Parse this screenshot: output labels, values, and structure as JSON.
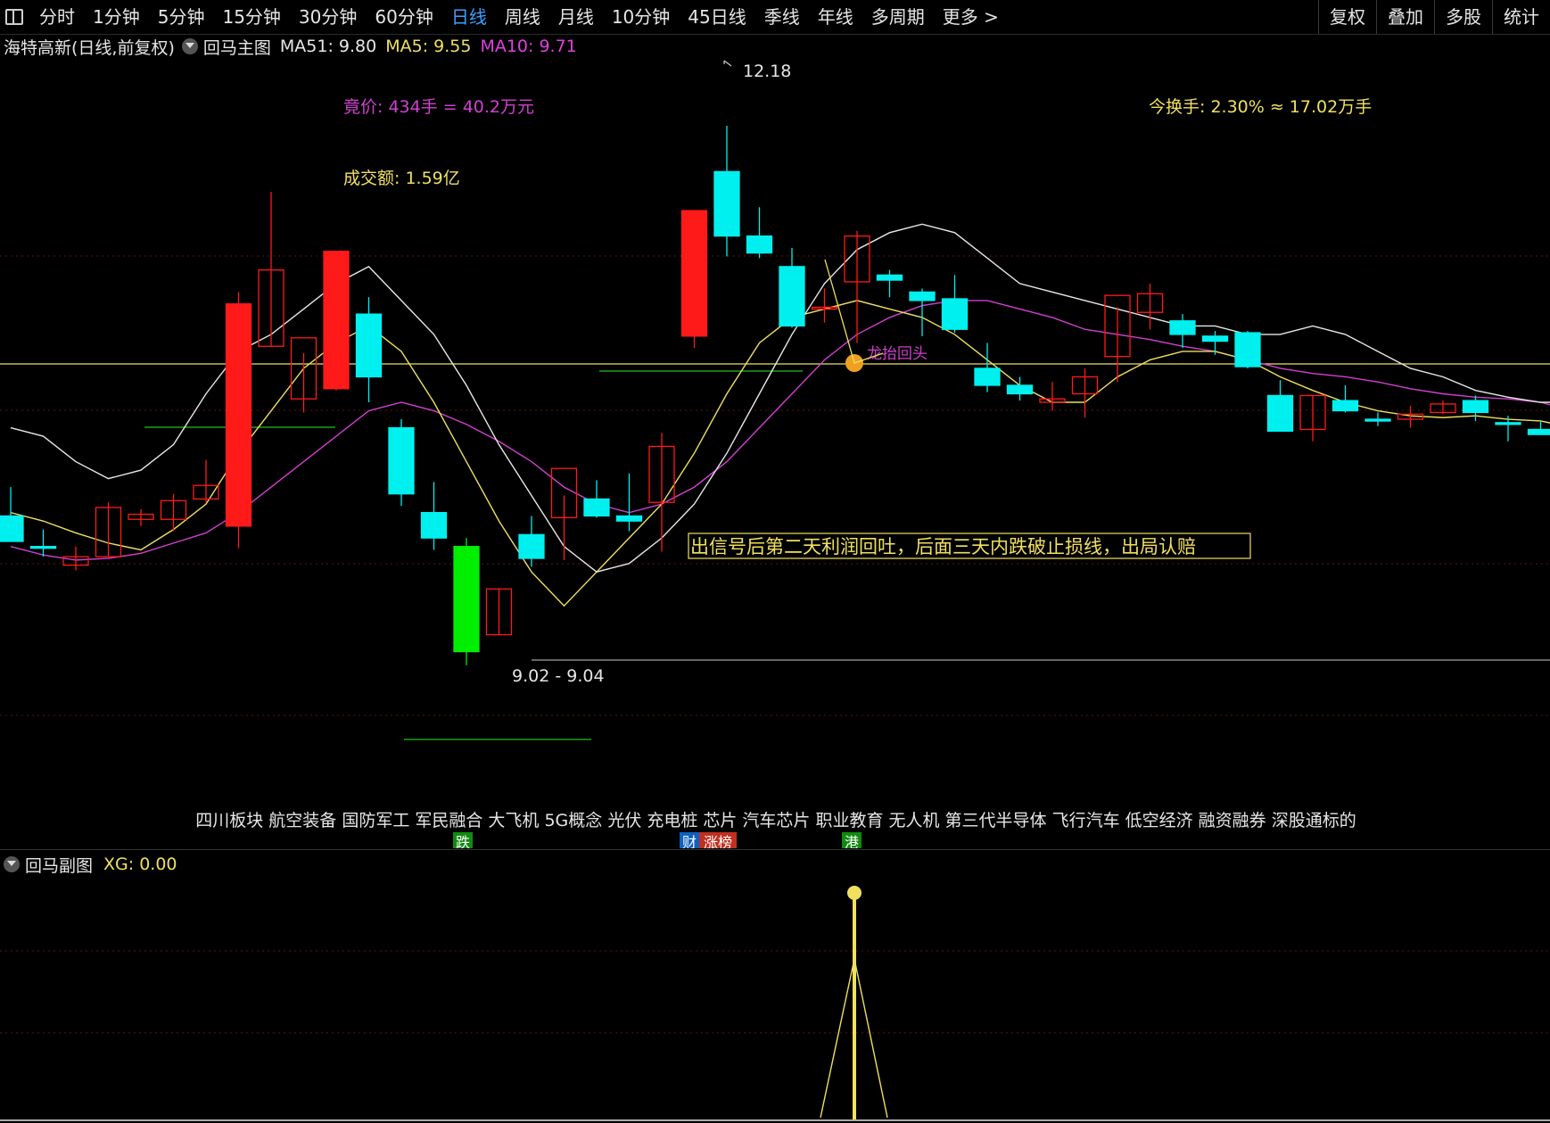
{
  "toolbar": {
    "tabs": [
      "分时",
      "1分钟",
      "5分钟",
      "15分钟",
      "30分钟",
      "60分钟",
      "日线",
      "周线",
      "月线",
      "10分钟",
      "45日线",
      "季线",
      "年线",
      "多周期",
      "更多 >"
    ],
    "active_index": 6,
    "right_buttons": [
      "复权",
      "叠加",
      "多股",
      "统计"
    ]
  },
  "info": {
    "stock_title": "海特高新(日线,前复权)",
    "indicator_name": "回马主图",
    "ma51": "MA51: 9.80",
    "ma5": "MA5: 9.55",
    "ma10": "MA10: 9.71"
  },
  "annotations": {
    "bid": "竟价: 434手 = 40.2万元",
    "volume": "成交额: 1.59亿",
    "turnover": "今换手: 2.30% ≈ 17.02万手",
    "high_label": "12.18",
    "low_label": "9.02 - 9.04",
    "signal_text": "出信号后第二天利润回吐，后面三天内跌破止损线，出局认赔",
    "signal_marker": "龙抬回头",
    "sectors": "四川板块 航空装备 国防军工 军民融合 大飞机 5G概念 光伏 充电桩 芯片 汽车芯片 职业教育 无人机 第三代半导体 飞行汽车 低空经济 融资融券 深股通标的",
    "badge_die": "跌",
    "badge_cai": "财",
    "badge_zhang": "涨榜",
    "badge_gang": "港"
  },
  "sub": {
    "name": "回马副图",
    "xg": "XG: 0.00"
  },
  "colors": {
    "up": "#ff1a1a",
    "down_cyan": "#00f0f0",
    "down_green": "#00ee00",
    "ma_white": "#e8e8e8",
    "ma_yellow": "#f0e060",
    "ma_magenta": "#d040d0",
    "active_tab": "#3aa0ff"
  },
  "chart_data": {
    "type": "candlestick",
    "symbol": "海特高新",
    "high": 12.18,
    "low_range": "9.02 - 9.04",
    "candles": [
      {
        "o": 9.88,
        "h": 10.05,
        "l": 9.75,
        "c": 9.73
      },
      {
        "o": 9.7,
        "h": 9.8,
        "l": 9.64,
        "c": 9.69
      },
      {
        "o": 9.59,
        "h": 9.7,
        "l": 9.56,
        "c": 9.64
      },
      {
        "o": 9.64,
        "h": 9.96,
        "l": 9.64,
        "c": 9.93
      },
      {
        "o": 9.86,
        "h": 9.92,
        "l": 9.82,
        "c": 9.89
      },
      {
        "o": 9.86,
        "h": 10.01,
        "l": 9.79,
        "c": 9.97
      },
      {
        "o": 9.98,
        "h": 10.21,
        "l": 9.96,
        "c": 10.06
      },
      {
        "o": 9.82,
        "h": 11.2,
        "l": 9.69,
        "c": 11.13
      },
      {
        "o": 10.88,
        "h": 11.79,
        "l": 10.88,
        "c": 11.33
      },
      {
        "o": 10.57,
        "h": 10.84,
        "l": 10.49,
        "c": 10.93
      },
      {
        "o": 10.63,
        "h": 11.44,
        "l": 10.62,
        "c": 11.44
      },
      {
        "o": 11.07,
        "h": 11.17,
        "l": 10.55,
        "c": 10.7
      },
      {
        "o": 10.4,
        "h": 10.45,
        "l": 9.94,
        "c": 10.01
      },
      {
        "o": 9.9,
        "h": 10.08,
        "l": 9.68,
        "c": 9.75
      },
      {
        "o": 9.7,
        "h": 9.75,
        "l": 9.0,
        "c": 9.08
      },
      {
        "o": 9.18,
        "h": 9.45,
        "l": 9.18,
        "c": 9.45
      },
      {
        "o": 9.77,
        "h": 9.88,
        "l": 9.58,
        "c": 9.63
      },
      {
        "o": 9.87,
        "h": 10.0,
        "l": 9.62,
        "c": 10.16
      },
      {
        "o": 9.98,
        "h": 10.09,
        "l": 9.87,
        "c": 9.88
      },
      {
        "o": 9.88,
        "h": 10.13,
        "l": 9.79,
        "c": 9.85
      },
      {
        "o": 9.96,
        "h": 10.37,
        "l": 9.67,
        "c": 10.29
      },
      {
        "o": 10.94,
        "h": 11.61,
        "l": 10.87,
        "c": 11.68
      },
      {
        "o": 11.91,
        "h": 12.18,
        "l": 11.41,
        "c": 11.53
      },
      {
        "o": 11.53,
        "h": 11.7,
        "l": 11.4,
        "c": 11.43
      },
      {
        "o": 11.35,
        "h": 11.46,
        "l": 10.99,
        "c": 11.0
      },
      {
        "o": 11.1,
        "h": 11.22,
        "l": 11.02,
        "c": 11.11
      },
      {
        "o": 11.26,
        "h": 11.56,
        "l": 10.9,
        "c": 11.53
      },
      {
        "o": 11.3,
        "h": 11.33,
        "l": 11.17,
        "c": 11.27
      },
      {
        "o": 11.2,
        "h": 11.22,
        "l": 10.94,
        "c": 11.15
      },
      {
        "o": 11.16,
        "h": 11.3,
        "l": 10.96,
        "c": 10.98
      },
      {
        "o": 10.75,
        "h": 10.9,
        "l": 10.61,
        "c": 10.65
      },
      {
        "o": 10.65,
        "h": 10.7,
        "l": 10.56,
        "c": 10.6
      },
      {
        "o": 10.55,
        "h": 10.67,
        "l": 10.5,
        "c": 10.57
      },
      {
        "o": 10.6,
        "h": 10.75,
        "l": 10.46,
        "c": 10.7
      },
      {
        "o": 10.82,
        "h": 11.11,
        "l": 10.67,
        "c": 11.18
      },
      {
        "o": 11.08,
        "h": 11.25,
        "l": 10.98,
        "c": 11.19
      },
      {
        "o": 11.03,
        "h": 11.07,
        "l": 10.87,
        "c": 10.95
      },
      {
        "o": 10.94,
        "h": 10.97,
        "l": 10.83,
        "c": 10.91
      },
      {
        "o": 10.96,
        "h": 10.97,
        "l": 10.75,
        "c": 10.76
      },
      {
        "o": 10.59,
        "h": 10.68,
        "l": 10.38,
        "c": 10.38
      },
      {
        "o": 10.39,
        "h": 10.59,
        "l": 10.32,
        "c": 10.59
      },
      {
        "o": 10.56,
        "h": 10.65,
        "l": 10.49,
        "c": 10.5
      },
      {
        "o": 10.45,
        "h": 10.49,
        "l": 10.41,
        "c": 10.44
      },
      {
        "o": 10.45,
        "h": 10.53,
        "l": 10.4,
        "c": 10.48
      },
      {
        "o": 10.49,
        "h": 10.56,
        "l": 10.48,
        "c": 10.54
      },
      {
        "o": 10.56,
        "h": 10.59,
        "l": 10.44,
        "c": 10.49
      },
      {
        "o": 10.43,
        "h": 10.47,
        "l": 10.32,
        "c": 10.42
      },
      {
        "o": 10.39,
        "h": 10.44,
        "l": 10.36,
        "c": 10.36
      }
    ],
    "ma_white": [
      10.4,
      10.35,
      10.2,
      10.1,
      10.15,
      10.3,
      10.6,
      10.85,
      10.95,
      11.1,
      11.25,
      11.35,
      11.15,
      10.95,
      10.65,
      10.3,
      10.0,
      9.7,
      9.55,
      9.6,
      9.75,
      9.95,
      10.25,
      10.6,
      10.95,
      11.25,
      11.45,
      11.55,
      11.6,
      11.55,
      11.4,
      11.25,
      11.2,
      11.15,
      11.1,
      11.05,
      11.0,
      11.0,
      10.95,
      10.95,
      11.0,
      10.95,
      10.85,
      10.75,
      10.7,
      10.62,
      10.58,
      10.55,
      10.55
    ],
    "ma_yellow": [
      9.9,
      9.85,
      9.78,
      9.72,
      9.68,
      9.8,
      9.95,
      10.25,
      10.5,
      10.75,
      10.9,
      11.0,
      10.85,
      10.55,
      10.2,
      9.85,
      9.55,
      9.35,
      9.55,
      9.75,
      9.95,
      10.25,
      10.6,
      10.9,
      11.05,
      11.1,
      11.15,
      11.1,
      11.05,
      10.95,
      10.8,
      10.65,
      10.55,
      10.55,
      10.7,
      10.8,
      10.85,
      10.85,
      10.8,
      10.7,
      10.62,
      10.55,
      10.5,
      10.47,
      10.46,
      10.47,
      10.45,
      10.44,
      10.4
    ],
    "ma_magenta": [
      9.7,
      9.65,
      9.62,
      9.63,
      9.66,
      9.72,
      9.78,
      9.9,
      10.05,
      10.2,
      10.35,
      10.5,
      10.55,
      10.5,
      10.42,
      10.32,
      10.2,
      10.05,
      9.95,
      9.9,
      9.95,
      10.05,
      10.2,
      10.4,
      10.6,
      10.8,
      10.95,
      11.05,
      11.12,
      11.15,
      11.15,
      11.1,
      11.05,
      10.98,
      10.95,
      10.92,
      10.88,
      10.85,
      10.8,
      10.75,
      10.72,
      10.7,
      10.67,
      10.63,
      10.6,
      10.58,
      10.57,
      10.55,
      10.5
    ],
    "sub_xg": 0.0
  }
}
